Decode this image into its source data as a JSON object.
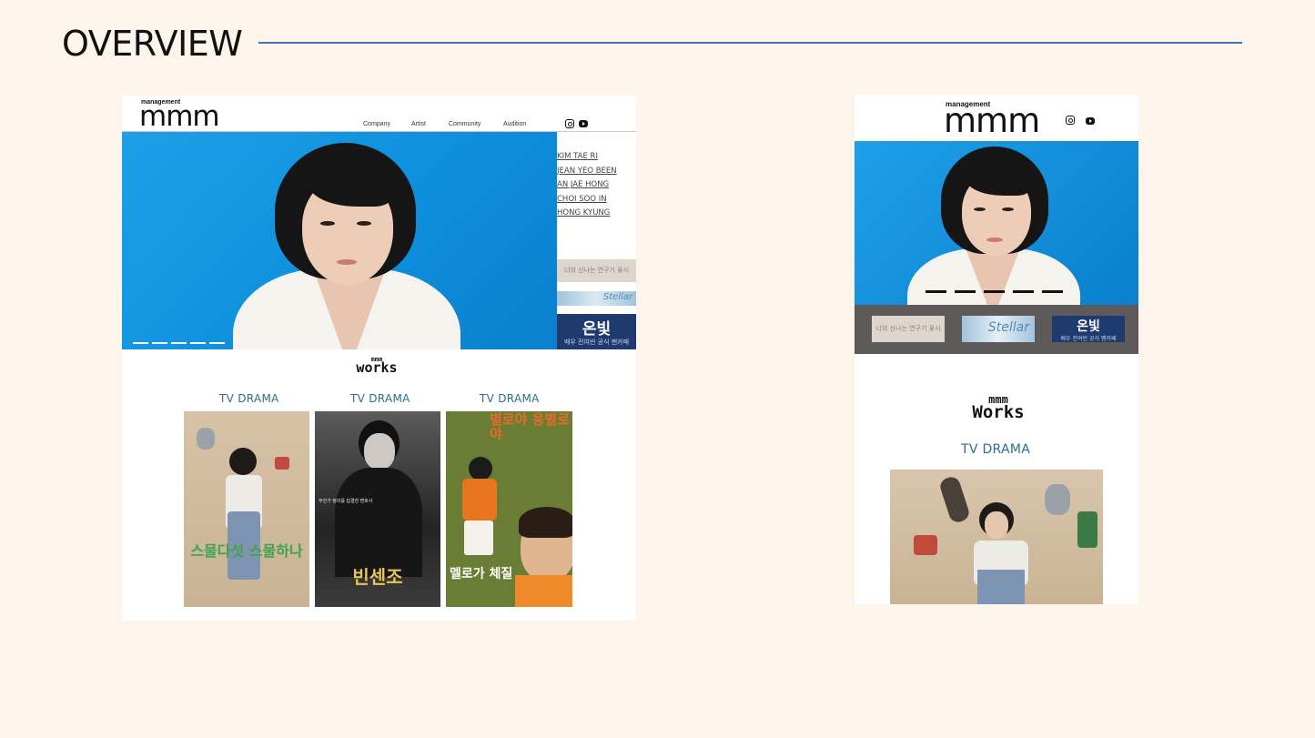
{
  "slide": {
    "title": "OVERVIEW"
  },
  "brand": {
    "top": "management",
    "mmm": "mmm",
    "works_line1": "mmm",
    "works_line2": "works",
    "works_line2_mobile": "Works"
  },
  "nav": [
    "Company",
    "Artist",
    "Community",
    "Audition"
  ],
  "artists": [
    "KIM TAE RI",
    "JEAN YEO BEEN",
    "AN JAE HONG",
    "CHOI SOO IN",
    "HONG KYUNG"
  ],
  "banners": {
    "b1": "너의 신나는 연구기 꽃시",
    "b2": "Stellar",
    "b3_title": "온빛",
    "b3_sub": "배우 전여빈 공식 팬카페"
  },
  "sections": {
    "drama_label": "TV  DRAMA",
    "drama_label_mobile": "TV DRAMA"
  },
  "posters": [
    {
      "title": "스물다섯 스물하나",
      "sub": "",
      "tint": "#d9c6ad"
    },
    {
      "title": "빈센조",
      "sub": "무언가 정의를 집결한 변호사",
      "tint": "#2b2b2b"
    },
    {
      "title": "멜로가 체질",
      "sub": "별로야 응별로야",
      "tint": "#6a7d35"
    }
  ],
  "colors": {
    "accent_rule": "#4a6fb5",
    "hero_blue": "#1196e0",
    "drama_teal": "#2a6f8e"
  }
}
